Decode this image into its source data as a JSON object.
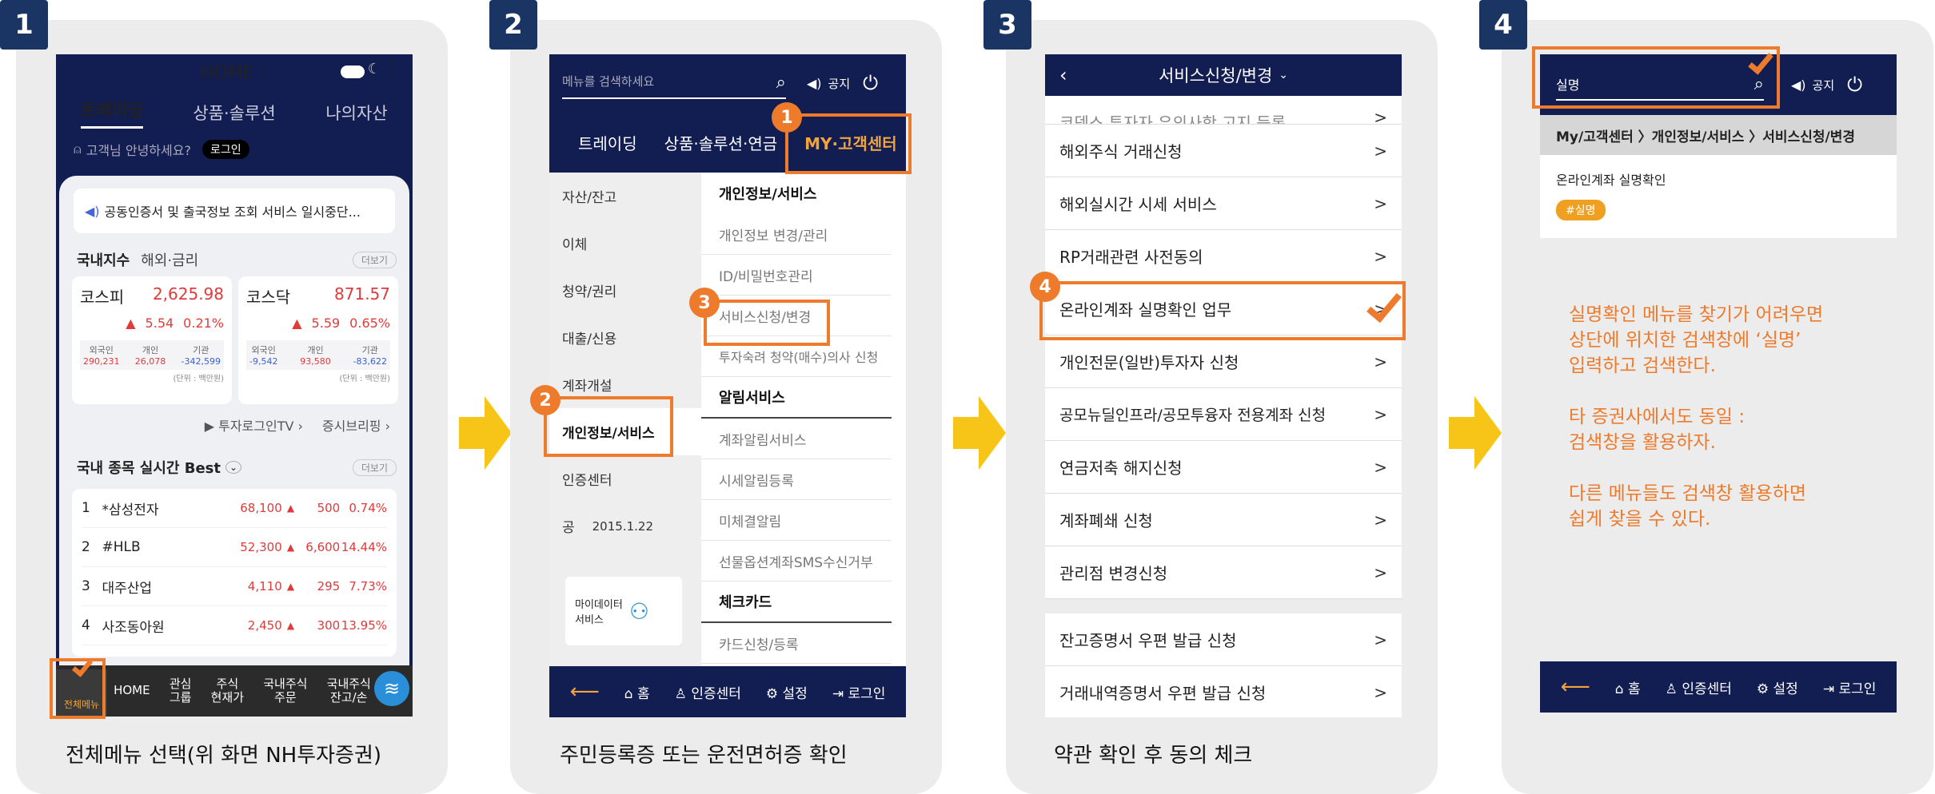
{
  "steps": [
    {
      "num": "1",
      "caption": "전체메뉴 선택(위 화면 NH투자증권)"
    },
    {
      "num": "2",
      "caption": "주민등록증 또는 운전면허증 확인"
    },
    {
      "num": "3",
      "caption": "약관 확인 후 동의 체크"
    },
    {
      "num": "4",
      "caption": ""
    }
  ],
  "colors": {
    "navy": "#121d52",
    "orange": "#ee7a2b",
    "arrow": "#f7c418",
    "badge": "#1a3563"
  },
  "p1": {
    "title": "HOME",
    "tabs": [
      "트레이딩",
      "상품·솔루션",
      "나의자산"
    ],
    "greeting": "고객님 안녕하세요?",
    "login": "로그인",
    "notice": "공동인증서 및 출국정보 조회 서비스 일시중단...",
    "idx_tabs": [
      "국내지수",
      "해외·금리"
    ],
    "more": "더보기",
    "kospi": {
      "name": "코스피",
      "value": "2,625.98",
      "chg": "5.54",
      "pct": "0.21%",
      "lbl": [
        "외국인",
        "개인",
        "기관"
      ],
      "vals": [
        "290,231",
        "26,078",
        "-342,599"
      ]
    },
    "kosdaq": {
      "name": "코스닥",
      "value": "871.57",
      "chg": "5.59",
      "pct": "0.65%",
      "lbl": [
        "외국인",
        "개인",
        "기관"
      ],
      "vals": [
        "-9,542",
        "93,580",
        "-83,622"
      ]
    },
    "unit": "(단위 : 백만원)",
    "tv": "투자로그인TV",
    "briefing": "증시브리핑",
    "best_title": "국내 종목 실시간 Best",
    "stocks": [
      {
        "rank": "1",
        "name": "*삼성전자",
        "price": "68,100",
        "chg": "500",
        "pct": "0.74%"
      },
      {
        "rank": "2",
        "name": "#HLB",
        "price": "52,300",
        "chg": "6,600",
        "pct": "14.44%"
      },
      {
        "rank": "3",
        "name": "대주산업",
        "price": "4,110",
        "chg": "295",
        "pct": "7.73%"
      },
      {
        "rank": "4",
        "name": "사조동아원",
        "price": "2,450",
        "chg": "300",
        "pct": "13.95%"
      }
    ],
    "bottom": [
      "전체메뉴",
      "HOME",
      "관심\n그룹",
      "주식\n현재가",
      "국내주식\n주문",
      "국내주식\n잔고/손"
    ]
  },
  "p2": {
    "search_placeholder": "메뉴를 검색하세요",
    "notice": "공지",
    "tabs": [
      "트레이딩",
      "상품·솔루션·연금",
      "MY·고객센터"
    ],
    "left": [
      "자산/잔고",
      "이체",
      "청약/권리",
      "대출/신용",
      "계좌개설",
      "개인정보/서비스",
      "인증센터",
      "공"
    ],
    "date": "2015.1.22",
    "sec1": "개인정보/서비스",
    "items1": [
      "개인정보 변경/관리",
      "ID/비밀번호관리",
      "서비스신청/변경",
      "투자숙려 청약(매수)의사 신청"
    ],
    "sec2": "알림서비스",
    "items2": [
      "계좌알림서비스",
      "시세알림등록",
      "미체결알림",
      "선물옵션계좌SMS수신거부"
    ],
    "sec3": "체크카드",
    "items3": [
      "카드신청/등록"
    ],
    "banner": "마이데이터\n서비스",
    "bottom": [
      "홈",
      "인증센터",
      "설정",
      "로그인"
    ],
    "marks": [
      "1",
      "2",
      "3"
    ]
  },
  "p3": {
    "title": "서비스신청/변경",
    "top_cut": "코덱스 투자자 유의사항 고지 등록",
    "items": [
      "해외주식 거래신청",
      "해외실시간 시세 서비스",
      "RP거래관련 사전동의",
      "온라인계좌 실명확인 업무",
      "개인전문(일반)투자자 신청",
      "공모뉴딜인프라/공모투융자 전용계좌 신청",
      "연금저축 해지신청",
      "계좌폐쇄 신청",
      "관리점 변경신청"
    ],
    "items_b": [
      "잔고증명서 우편 발급 신청",
      "거래내역증명서 우편 발급 신청"
    ],
    "gt": ">",
    "mark": "4"
  },
  "p4": {
    "search_value": "실명",
    "notice": "공지",
    "breadcrumb": "My/고객센터 〉개인정보/서비스 〉서비스신청/변경",
    "result": "온라인계좌 실명확인",
    "tag": "#실명",
    "tip": [
      "실명확인 메뉴를 찾기가 어려우면",
      "상단에 위치한 검색창에 ‘실명’",
      "입력하고 검색한다.",
      "",
      "타 증권사에서도 동일 :",
      "검색창을 활용하자.",
      "",
      "다른 메뉴들도 검색창 활용하면",
      "쉽게 찾을 수 있다."
    ],
    "bottom": [
      "홈",
      "인증센터",
      "설정",
      "로그인"
    ]
  }
}
